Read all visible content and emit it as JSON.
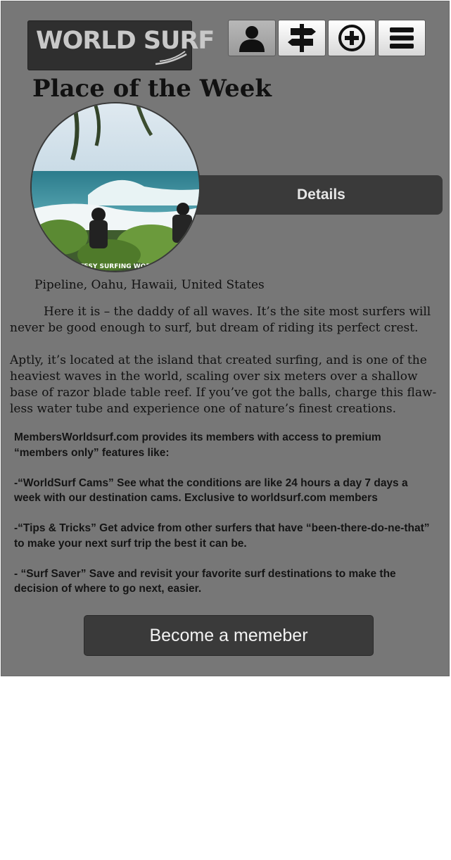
{
  "header": {
    "logo_text": "WORLD SURF",
    "nav": [
      {
        "icon": "user-icon",
        "active": true
      },
      {
        "icon": "signpost-icon",
        "active": false
      },
      {
        "icon": "add-circle-icon",
        "active": false
      },
      {
        "icon": "menu-icon",
        "active": false
      }
    ]
  },
  "place": {
    "heading": "Place of the Week",
    "details_label": "Details",
    "photo_credit": "COURTESY SURFING WORLD",
    "location": "Pipeline, Oahu, Hawaii, United States",
    "paragraphs": [
      "Here it is – the daddy of all waves. It’s the site most surfers will never be good enough to surf, but dream of riding its perfect crest.",
      "Aptly, it’s located at the island that created surfing, and is one of the heaviest waves in the world, scaling over six meters over a shallow base of razor blade table reef. If you’ve got the balls, charge this flaw-less water tube and experience one of nature’s finest creations."
    ]
  },
  "members": {
    "intro": "MembersWorldsurf.com provides its members with access to premium “members only” features like:",
    "features": [
      "-“WorldSurf Cams” See what the conditions are like 24 hours a day 7 days a week with our destination cams. Exclusive to worldsurf.com members",
      "-“Tips & Tricks” Get advice from other surfers that have “been-there-do-ne-that” to make your next surf trip the best it can be.",
      "- “Surf Saver” Save and revisit your favorite surf destinations to make the decision of where to go next, easier."
    ],
    "cta_label": "Become a memeber"
  },
  "colors": {
    "background": "#777777",
    "dark_bar": "#3a3a3a",
    "text": "#111111"
  }
}
